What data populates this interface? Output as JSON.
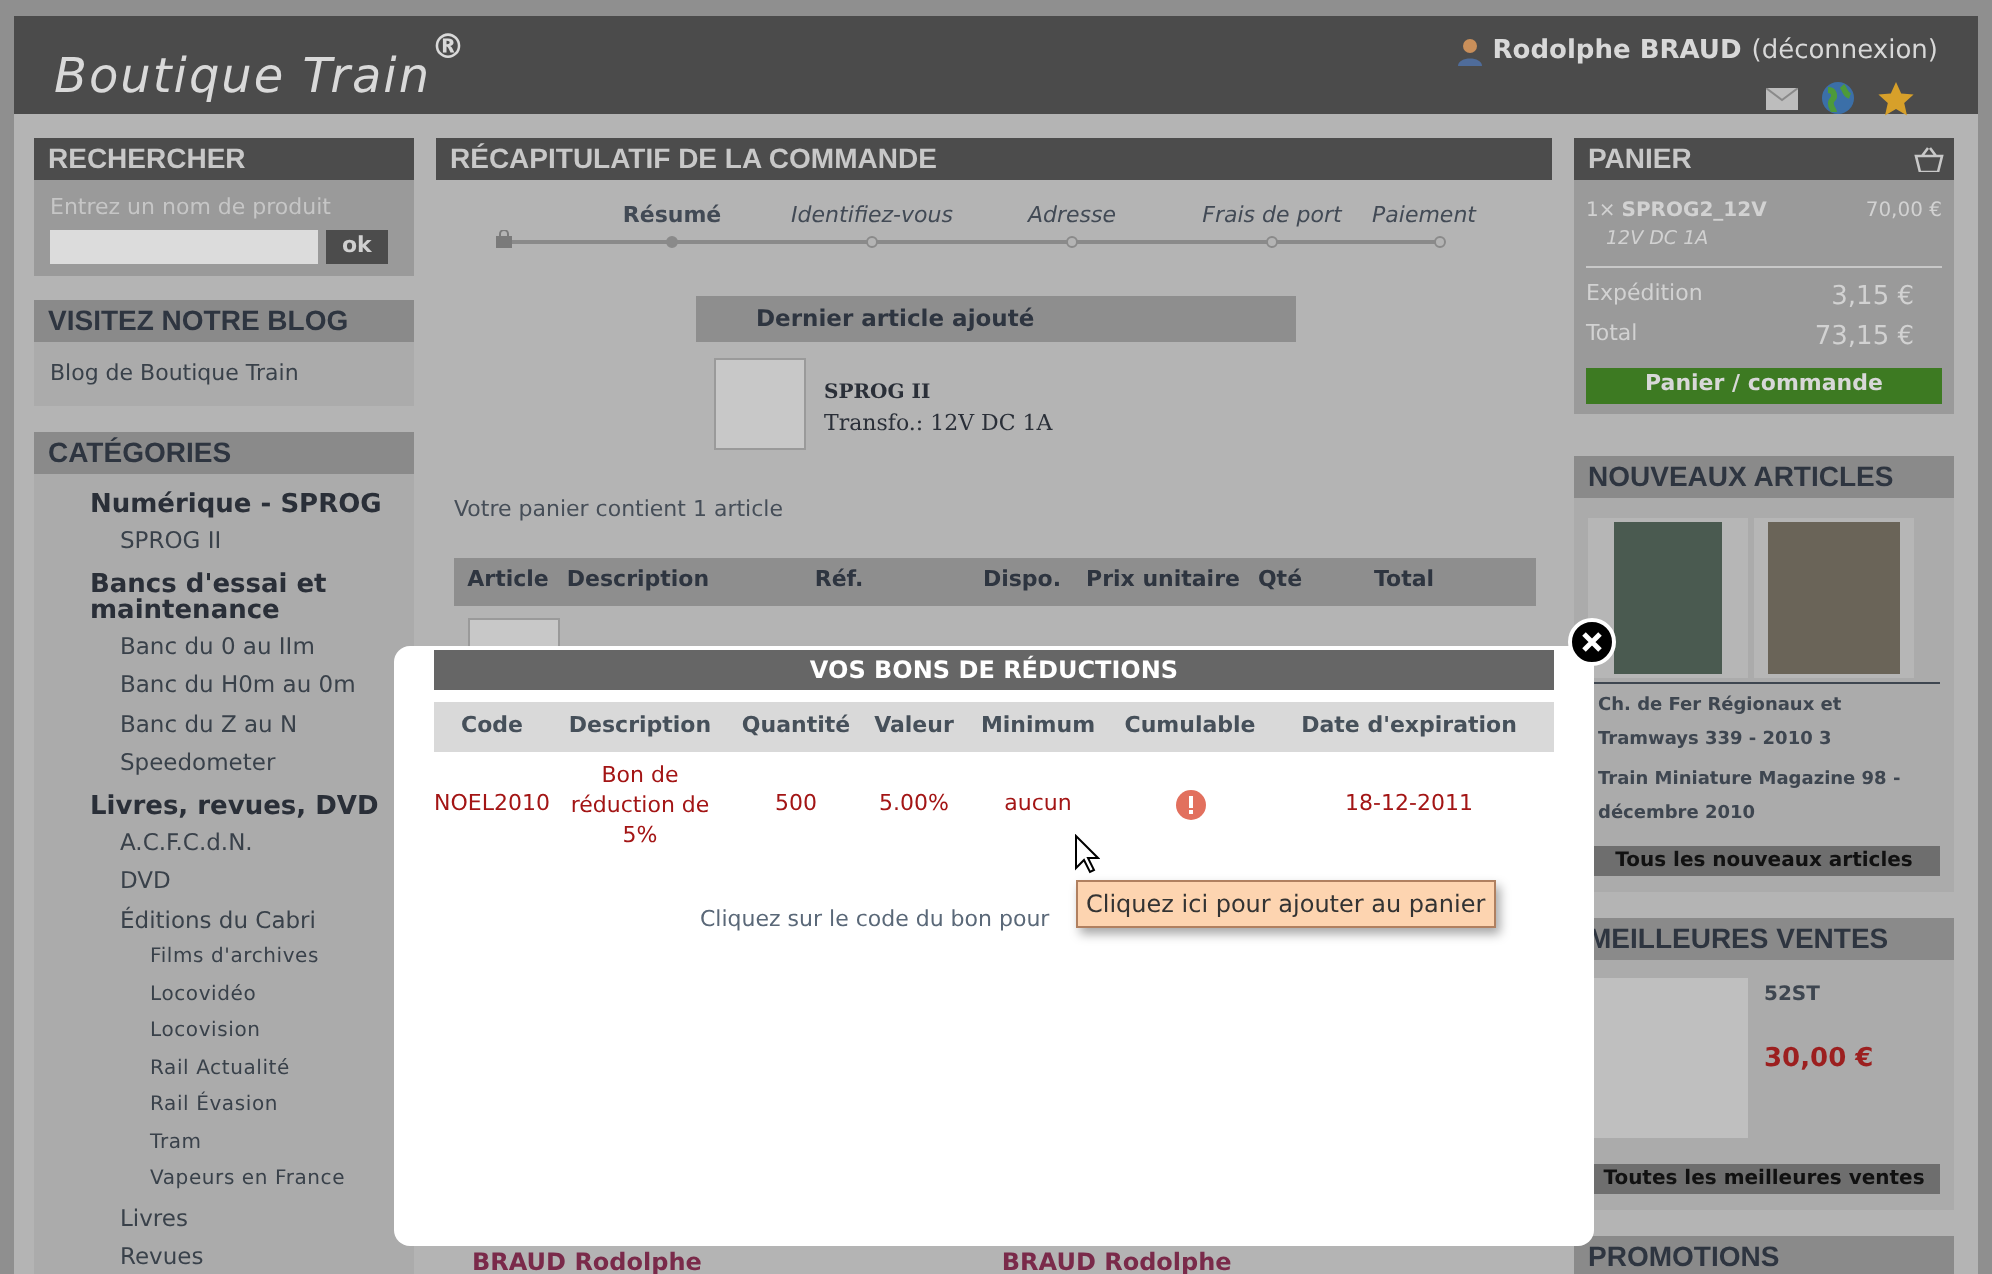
{
  "header": {
    "logo": "Boutique Train",
    "logo_mark": "®",
    "user_name": "Rodolphe BRAUD",
    "logout": "(déconnexion)"
  },
  "search": {
    "title": "RECHERCHER",
    "placeholder": "Entrez un nom de produit",
    "button": "ok"
  },
  "blog": {
    "title": "VISITEZ NOTRE BLOG",
    "link": "Blog de Boutique Train"
  },
  "categories": {
    "title": "CATÉGORIES",
    "items": [
      {
        "label": "Numérique - SPROG",
        "children": [
          {
            "label": "SPROG II"
          }
        ]
      },
      {
        "label": "Bancs d'essai et maintenance",
        "children": [
          {
            "label": "Banc du 0 au IIm"
          },
          {
            "label": "Banc du H0m au 0m"
          },
          {
            "label": "Banc du Z au N"
          },
          {
            "label": "Speedometer"
          }
        ]
      },
      {
        "label": "Livres, revues, DVD",
        "children": [
          {
            "label": "A.C.F.C.d.N."
          },
          {
            "label": "DVD"
          },
          {
            "label": "Éditions du Cabri",
            "children": [
              {
                "label": "Films d'archives"
              },
              {
                "label": "Locovidéo"
              },
              {
                "label": "Locovision"
              },
              {
                "label": "Rail Actualité"
              },
              {
                "label": "Rail Évasion"
              },
              {
                "label": "Tram"
              },
              {
                "label": "Vapeurs en France"
              }
            ]
          },
          {
            "label": "Livres"
          },
          {
            "label": "Revues"
          }
        ]
      }
    ]
  },
  "order": {
    "title": "RÉCAPITULATIF DE LA COMMANDE",
    "steps": [
      {
        "label": "Résumé",
        "selected": true
      },
      {
        "label": "Identifiez-vous",
        "selected": false
      },
      {
        "label": "Adresse",
        "selected": false
      },
      {
        "label": "Frais de port",
        "selected": false
      },
      {
        "label": "Paiement",
        "selected": false
      }
    ],
    "last_added": {
      "title": "Dernier article ajouté",
      "name": "SPROG II",
      "description": "Transfo.: 12V DC 1A"
    },
    "cart_count": "Votre panier contient 1 article",
    "columns": [
      "Article",
      "Description",
      "Réf.",
      "Dispo.",
      "Prix unitaire",
      "Qté",
      "Total"
    ],
    "addresses": [
      "BRAUD Rodolphe",
      "BRAUD Rodolphe"
    ]
  },
  "modal": {
    "title": "VOS BONS DE RÉDUCTIONS",
    "columns": [
      "Code",
      "Description",
      "Quantité",
      "Valeur",
      "Minimum",
      "Cumulable",
      "Date d'expiration"
    ],
    "rows": [
      {
        "code": "NOEL2010",
        "description": "Bon de réduction de 5%",
        "quantity": "500",
        "value": "5.00%",
        "minimum": "aucun",
        "cumulable": false,
        "expiration": "18-12-2011"
      }
    ],
    "note": "Cliquez sur le code du bon pour",
    "tooltip": "Cliquez ici pour ajouter au panier"
  },
  "cart": {
    "title": "PANIER",
    "items": [
      {
        "quantity": "1×",
        "name": "SPROG2_12V",
        "price": "70,00 €",
        "option": "12V DC 1A"
      }
    ],
    "shipping_label": "Expédition",
    "shipping_value": "3,15 €",
    "total_label": "Total",
    "total_value": "73,15 €",
    "button": "Panier / commande"
  },
  "new_articles": {
    "title": "NOUVEAUX ARTICLES",
    "items": [
      {
        "title": "Ch. de Fer Régionaux et Tramways 339 - 2010 3"
      },
      {
        "title": "Train Miniature Magazine 98 - décembre 2010"
      }
    ],
    "button": "Tous les nouveaux articles"
  },
  "bestsellers": {
    "title": "MEILLEURES VENTES",
    "items": [
      {
        "name": "52ST",
        "price": "30,00 €"
      }
    ],
    "button": "Toutes les meilleures ventes"
  },
  "promotions": {
    "title": "PROMOTIONS"
  }
}
